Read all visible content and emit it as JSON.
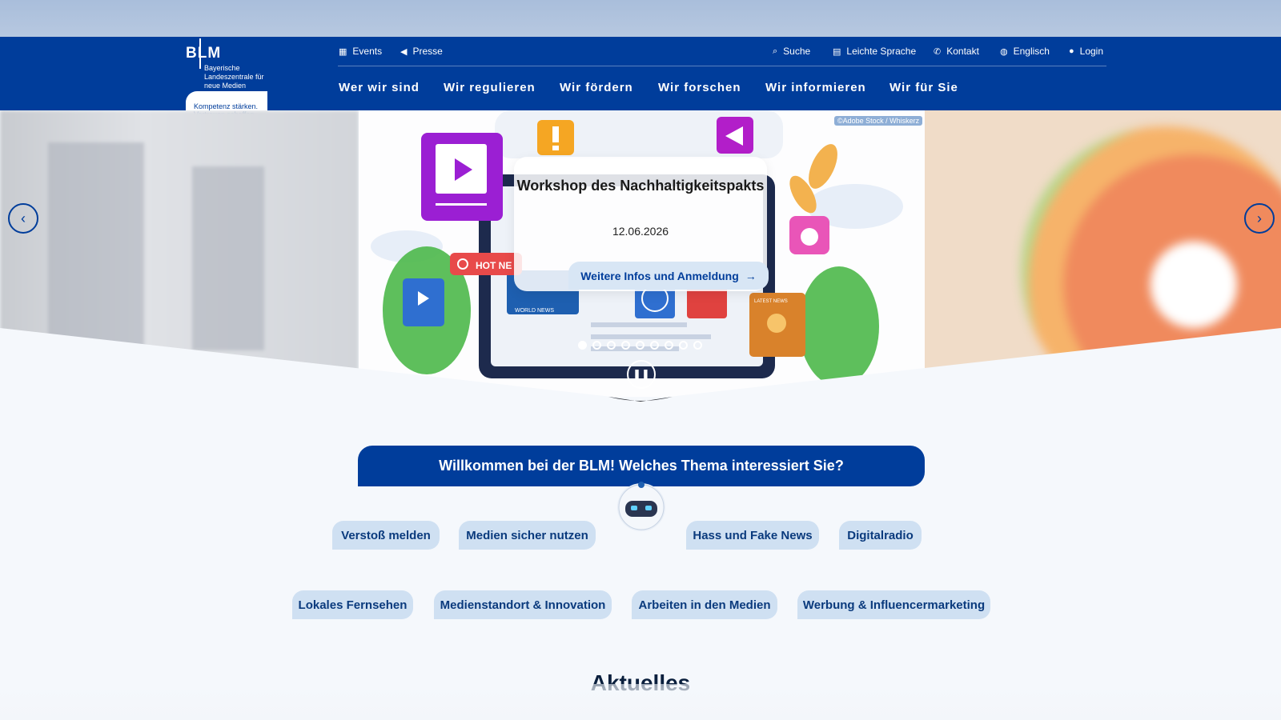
{
  "logo": {
    "mark": "BLM",
    "subtitle": "Bayerische Landeszentrale für neue Medien",
    "tagline": "Kompetenz stärken. Vertrauen schaffen."
  },
  "utility_left": [
    {
      "icon": "calendar-icon",
      "label": "Events"
    },
    {
      "icon": "megaphone-icon",
      "label": "Presse"
    }
  ],
  "utility_right": [
    {
      "icon": "search-icon",
      "label": "Suche"
    },
    {
      "icon": "easy-language-icon",
      "label": "Leichte Sprache"
    },
    {
      "icon": "phone-icon",
      "label": "Kontakt"
    },
    {
      "icon": "globe-icon",
      "label": "Englisch"
    },
    {
      "icon": "user-icon",
      "label": "Login"
    }
  ],
  "main_nav": [
    "Wer wir sind",
    "Wir regulieren",
    "Wir fördern",
    "Wir forschen",
    "Wir informieren",
    "Wir für Sie"
  ],
  "hero": {
    "image_credit": "©Adobe Stock / Whiskerz",
    "slide_title": "Workshop des Nachhaltigkeitspakts",
    "slide_date": "12.06.2026",
    "slide_button": "Weitere Infos und Anmeldung",
    "slide_count": 9,
    "active_slide": 1,
    "illustration_labels": {
      "hot": "HOT NE",
      "world": "WORLD NEWS",
      "latest": "LATEST NEWS"
    }
  },
  "welcome": "Willkommen bei der BLM! Welches Thema interessiert Sie?",
  "topics_row1": [
    "Verstoß melden",
    "Medien sicher nutzen",
    "Hass und Fake News",
    "Digitalradio"
  ],
  "topics_row2": [
    "Lokales Fernsehen",
    "Medienstandort & Innovation",
    "Arbeiten in den Medien",
    "Werbung & Influencermarketing"
  ],
  "section_heading": "Aktuelles",
  "colors": {
    "brand_blue": "#003d9b",
    "chip_bg": "#cfe0f2",
    "page_bg": "#f5f8fc"
  }
}
